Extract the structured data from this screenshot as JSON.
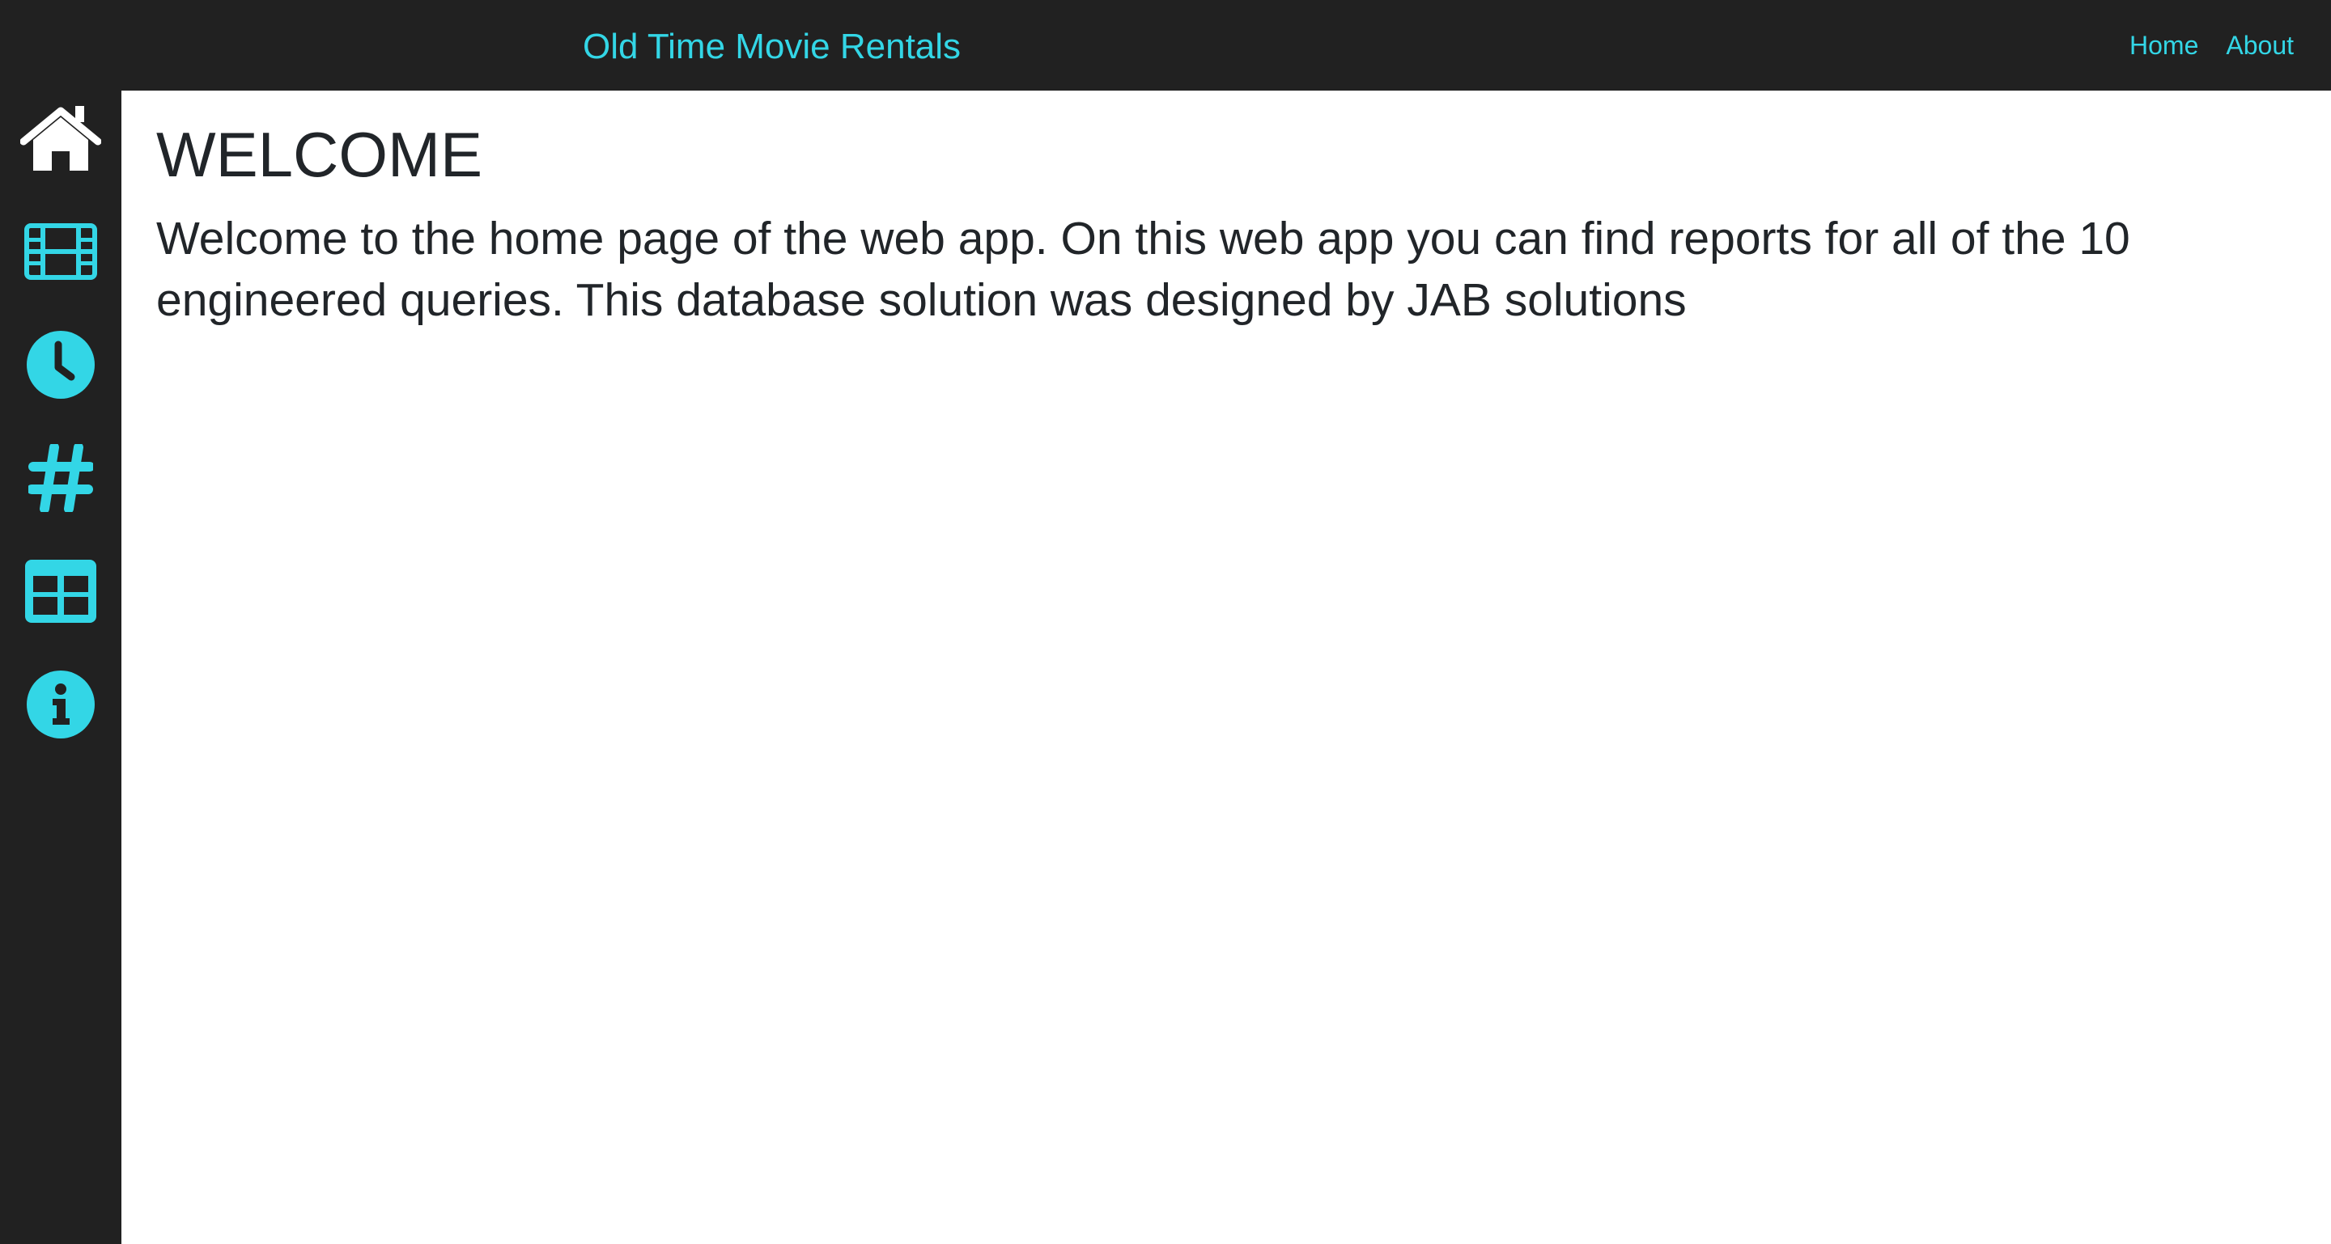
{
  "header": {
    "brand": "Old Time Movie Rentals",
    "nav": [
      {
        "label": "Home"
      },
      {
        "label": "About"
      }
    ]
  },
  "sidebar": {
    "items": [
      {
        "icon": "home-icon",
        "color": "#ffffff"
      },
      {
        "icon": "film-icon",
        "color": "#33d6e6"
      },
      {
        "icon": "clock-icon",
        "color": "#33d6e6"
      },
      {
        "icon": "hashtag-icon",
        "color": "#33d6e6"
      },
      {
        "icon": "table-icon",
        "color": "#33d6e6"
      },
      {
        "icon": "info-icon",
        "color": "#33d6e6"
      }
    ]
  },
  "main": {
    "heading": "WELCOME",
    "intro": "Welcome to the home page of the web app. On this web app you can find reports for all of the 10 engineered queries. This database solution was designed by JAB solutions"
  },
  "colors": {
    "accent": "#33d6e6",
    "chrome": "#212121",
    "text": "#212529",
    "background": "#ffffff"
  }
}
